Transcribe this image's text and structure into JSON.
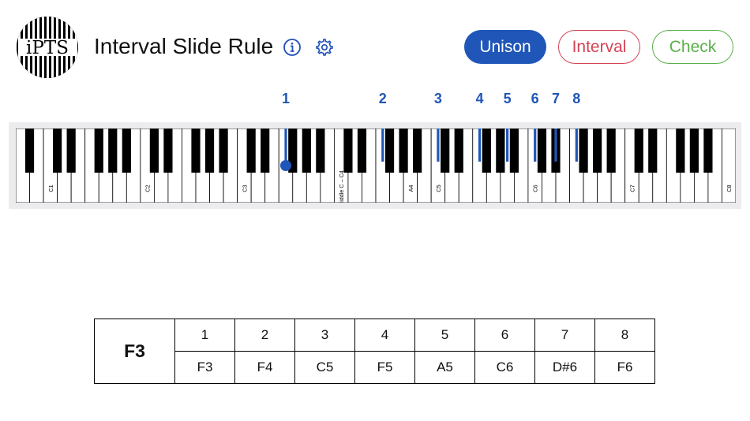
{
  "app": {
    "logo_text": "iPTS",
    "title": "Interval Slide Rule"
  },
  "toolbar": {
    "info_icon": "info-icon",
    "settings_icon": "gear-icon"
  },
  "modes": {
    "unison": "Unison",
    "interval": "Interval",
    "check": "Check",
    "active": "unison"
  },
  "colors": {
    "accent": "#1f56b8",
    "interval": "#d34456",
    "check": "#5ab04a"
  },
  "keyboard": {
    "first_note": "A0",
    "white_key_count": 52,
    "labels": [
      {
        "text": "C1",
        "white_index": 2
      },
      {
        "text": "C2",
        "white_index": 9
      },
      {
        "text": "C3",
        "white_index": 16
      },
      {
        "text": "Middle C – C4",
        "white_index": 23
      },
      {
        "text": "A4",
        "white_index": 28
      },
      {
        "text": "C5",
        "white_index": 30
      },
      {
        "text": "C6",
        "white_index": 37
      },
      {
        "text": "C7",
        "white_index": 44
      },
      {
        "text": "C8",
        "white_index": 51
      }
    ]
  },
  "markers": [
    {
      "label": "1",
      "note": "F3",
      "semitone": 32,
      "root": true
    },
    {
      "label": "2",
      "note": "F4",
      "semitone": 44
    },
    {
      "label": "3",
      "note": "C5",
      "semitone": 51
    },
    {
      "label": "4",
      "note": "F5",
      "semitone": 56
    },
    {
      "label": "5",
      "note": "A5",
      "semitone": 60
    },
    {
      "label": "6",
      "note": "C6",
      "semitone": 63
    },
    {
      "label": "7",
      "note": "D#6",
      "semitone": 66
    },
    {
      "label": "8",
      "note": "F6",
      "semitone": 68
    }
  ],
  "results": {
    "root": "F3",
    "headers": [
      "1",
      "2",
      "3",
      "4",
      "5",
      "6",
      "7",
      "8"
    ],
    "values": [
      "F3",
      "F4",
      "C5",
      "F5",
      "A5",
      "C6",
      "D#6",
      "F6"
    ]
  }
}
